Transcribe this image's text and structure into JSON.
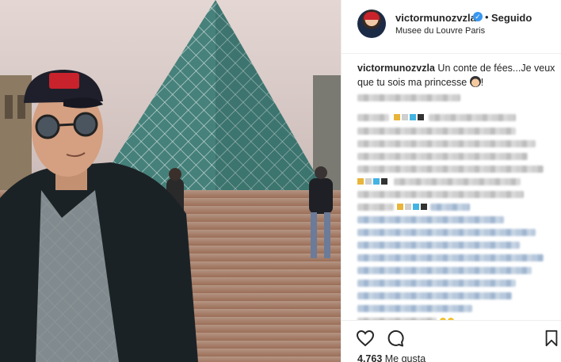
{
  "post": {
    "username": "victormunozvzla",
    "separator": "•",
    "follow_status": "Seguido",
    "location": "Musee du Louvre Paris"
  },
  "caption": {
    "username": "victormunozvzla",
    "text": "Un conte de fées...Je veux que tu sois ma princesse",
    "trailing": "!"
  },
  "likes": {
    "count": "4.763",
    "label": "Me gusta"
  },
  "icons": {
    "verified": "verified-badge-icon",
    "like": "heart-icon",
    "comment": "comment-bubble-icon",
    "save": "bookmark-icon"
  },
  "colors": {
    "verified_blue": "#3897f0",
    "text": "#262626",
    "divider": "#efefef"
  }
}
